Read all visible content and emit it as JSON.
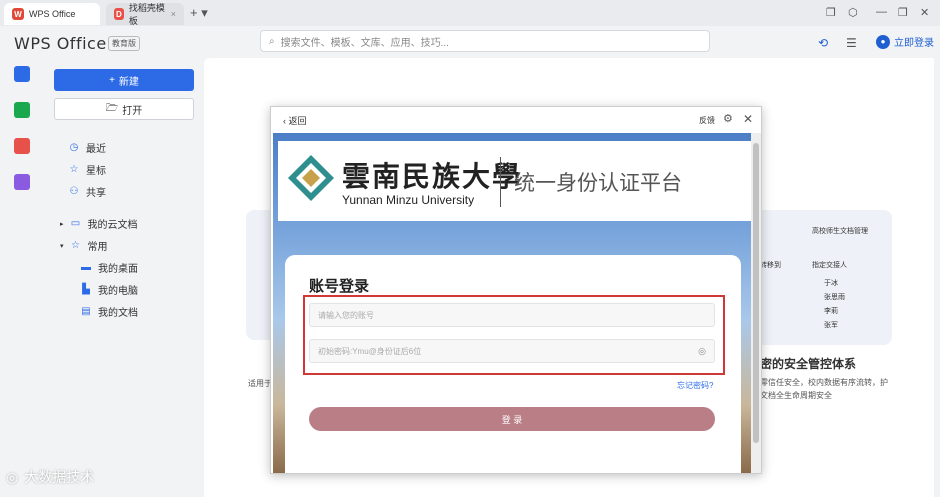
{
  "tabs": [
    {
      "label": "WPS Office",
      "active": true
    },
    {
      "label": "找稻壳模板",
      "active": false
    }
  ],
  "header": {
    "brand": "WPS Office",
    "edition": "教育版",
    "search_placeholder": "搜索文件、模板、文库、应用、技巧...",
    "login": "立即登录"
  },
  "sidebar": {
    "new": "新建",
    "open": "打开",
    "items": [
      {
        "label": "最近",
        "icon": "clock-icon"
      },
      {
        "label": "星标",
        "icon": "star-icon"
      },
      {
        "label": "共享",
        "icon": "share-icon"
      }
    ],
    "tree": [
      {
        "label": "我的云文档"
      },
      {
        "label": "常用"
      },
      {
        "label": "我的桌面"
      },
      {
        "label": "我的电脑"
      },
      {
        "label": "我的文档"
      }
    ]
  },
  "dialog": {
    "back": "返回",
    "feedback": "反馈"
  },
  "webpage": {
    "university_cn": "雲南民族大學",
    "university_en": "Yunnan Minzu University",
    "platform": "统一身份认证平台",
    "login_title": "账号登录",
    "account_placeholder": "请输入您的账号",
    "password_placeholder": "初始密码:Ymu@身份证后6位",
    "forgot": "忘记密码?",
    "submit": "登 录"
  },
  "background": {
    "feature_title": "密的安全管控体系",
    "feature_sub": "零信任安全，校内数据有序流转，护文档全生命周期安全",
    "left_text": "适用于",
    "card_header": "高校师生文档管理",
    "card_item1": "转移到",
    "card_item2": "指定交接人",
    "people": [
      "于冰",
      "张思雨",
      "李莉",
      "张军"
    ]
  },
  "watermark": "大数据技术"
}
